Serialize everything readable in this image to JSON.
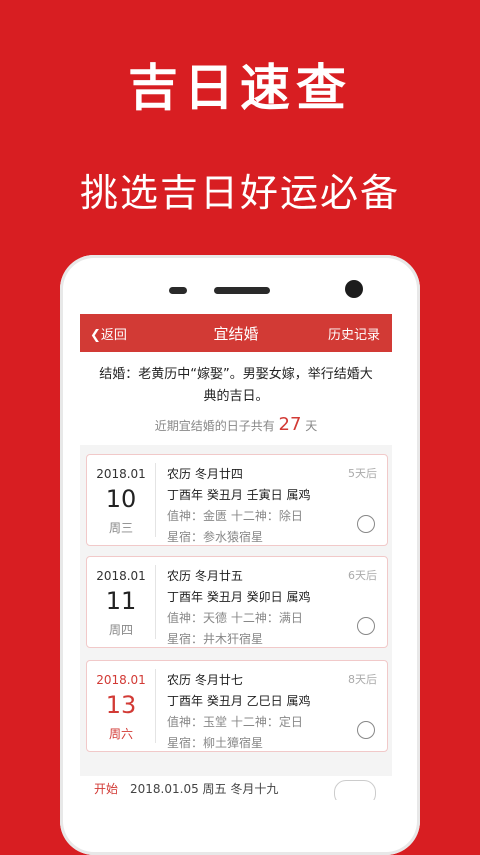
{
  "promo": {
    "title": "吉日速查",
    "subtitle": "挑选吉日好运必备"
  },
  "nav": {
    "back": "返回",
    "title": "宜结婚",
    "history": "历史记录"
  },
  "description": "结婚：老黄历中“嫁娶”。男娶女嫁，举行结婚大典的吉日。",
  "count": {
    "prefix": "近期宜结婚的日子共有",
    "number": "27",
    "suffix": "天"
  },
  "cards": [
    {
      "ym": "2018.01",
      "day": "10",
      "week": "周三",
      "lunar": "农历 冬月廿四",
      "ganzhi": "丁酉年 癸丑月 壬寅日 属鸡",
      "zhishen": "值神：金匮  十二神：除日",
      "xingsu": "星宿：参水猿宿星",
      "after": "5天后"
    },
    {
      "ym": "2018.01",
      "day": "11",
      "week": "周四",
      "lunar": "农历 冬月廿五",
      "ganzhi": "丁酉年 癸丑月 癸卯日 属鸡",
      "zhishen": "值神：天德  十二神：满日",
      "xingsu": "星宿：井木犴宿星",
      "after": "6天后"
    },
    {
      "ym": "2018.01",
      "day": "13",
      "week": "周六",
      "lunar": "农历 冬月廿七",
      "ganzhi": "丁酉年 癸丑月 乙巳日 属鸡",
      "zhishen": "值神：玉堂  十二神：定日",
      "xingsu": "星宿：柳土獐宿星",
      "after": "8天后"
    }
  ],
  "bottom": {
    "label": "开始",
    "text": "2018.01.05 周五 冬月十九"
  }
}
